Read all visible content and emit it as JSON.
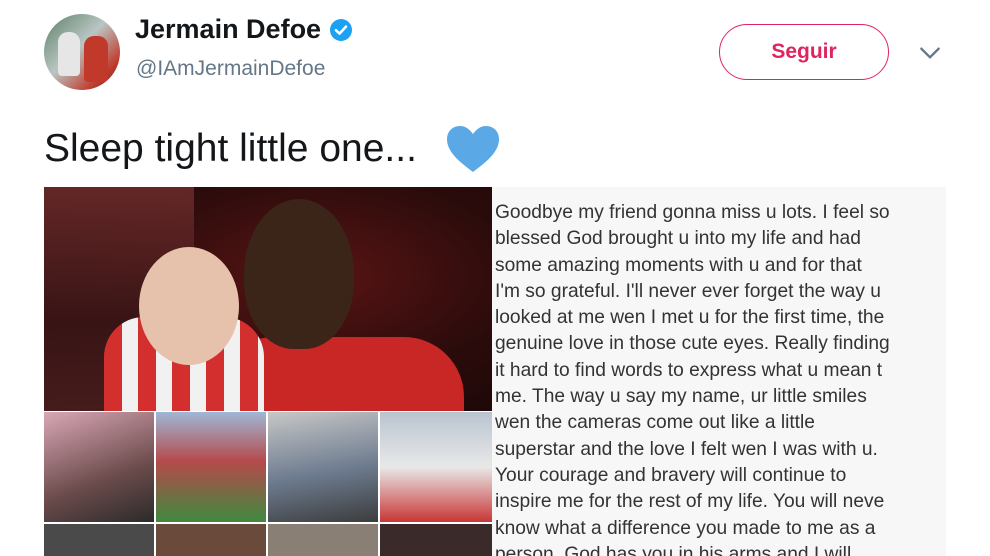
{
  "user": {
    "display_name": "Jermain Defoe",
    "handle": "@IAmJermainDefoe",
    "verified_icon": "verified-badge-icon"
  },
  "actions": {
    "follow_label": "Seguir",
    "menu_icon": "chevron-down-icon"
  },
  "tweet": {
    "text": "Sleep tight little one...",
    "emoji": "blue-heart-icon"
  },
  "media": {
    "letter_lines": [
      "Goodbye my friend gonna miss u lots. I feel so",
      "blessed God brought u into my life and had",
      "some amazing moments with u and for that",
      "I'm so grateful. I'll never ever forget the way u",
      "looked at me wen I met u for the first time, the",
      "genuine love in those cute eyes. Really finding",
      "it hard to find words to express what u mean t",
      "me. The way u say my name, ur little smiles",
      "wen the cameras come out like a little",
      "superstar and the love I felt wen I was with u.",
      "Your courage and bravery will continue to",
      "inspire me for the rest of my life. You will neve",
      "know what a difference you made to me as a",
      "person. God has you in his arms and I will"
    ]
  },
  "colors": {
    "accent": "#e0245e",
    "verified": "#1da1f2",
    "heart": "#5aa9e6",
    "handle": "#657786"
  }
}
